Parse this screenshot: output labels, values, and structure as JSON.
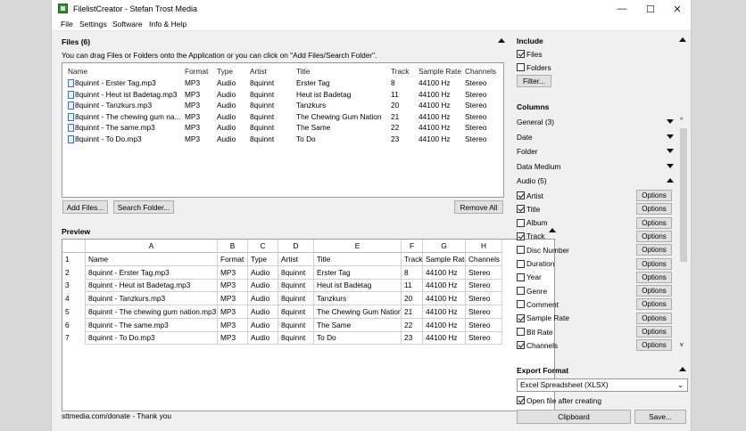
{
  "window": {
    "title": "FilelistCreator - Stefan Trost Media",
    "minimize": "—",
    "maximize": "☐",
    "close": "✕"
  },
  "menu": [
    "File",
    "Settings",
    "Software",
    "Info & Help"
  ],
  "files": {
    "header": "Files (6)",
    "hint": "You can drag Files or Folders onto the Application or you can click on \"Add Files/Search Folder\".",
    "columns": [
      "Name",
      "Format",
      "Type",
      "Artist",
      "Title",
      "Track",
      "Sample Rate",
      "Channels"
    ],
    "rows": [
      [
        "8quinnt - Erster Tag.mp3",
        "MP3",
        "Audio",
        "8quinnt",
        "Erster Tag",
        "8",
        "44100 Hz",
        "Stereo"
      ],
      [
        "8quinnt - Heut ist Badetag.mp3",
        "MP3",
        "Audio",
        "8quinnt",
        "Heut ist Badetag",
        "11",
        "44100 Hz",
        "Stereo"
      ],
      [
        "8quinnt - Tanzkurs.mp3",
        "MP3",
        "Audio",
        "8quinnt",
        "Tanzkurs",
        "20",
        "44100 Hz",
        "Stereo"
      ],
      [
        "8quinnt - The chewing gum na...",
        "MP3",
        "Audio",
        "8quinnt",
        "The Chewing Gum Nation",
        "21",
        "44100 Hz",
        "Stereo"
      ],
      [
        "8quinnt - The same.mp3",
        "MP3",
        "Audio",
        "8quinnt",
        "The Same",
        "22",
        "44100 Hz",
        "Stereo"
      ],
      [
        "8quinnt - To Do.mp3",
        "MP3",
        "Audio",
        "8quinnt",
        "To Do",
        "23",
        "44100 Hz",
        "Stereo"
      ]
    ],
    "add_files": "Add Files...",
    "search_folder": "Search Folder...",
    "remove_all": "Remove All"
  },
  "preview": {
    "header": "Preview",
    "col_letters": [
      "A",
      "B",
      "C",
      "D",
      "E",
      "F",
      "G",
      "H"
    ],
    "rows": [
      [
        "1",
        "Name",
        "Format",
        "Type",
        "Artist",
        "Title",
        "Track",
        "Sample Rate",
        "Channels"
      ],
      [
        "2",
        "8quinnt - Erster Tag.mp3",
        "MP3",
        "Audio",
        "8quinnt",
        "Erster Tag",
        "8",
        "44100 Hz",
        "Stereo"
      ],
      [
        "3",
        "8quinnt - Heut ist Badetag.mp3",
        "MP3",
        "Audio",
        "8quinnt",
        "Heut ist Badetag",
        "11",
        "44100 Hz",
        "Stereo"
      ],
      [
        "4",
        "8quinnt - Tanzkurs.mp3",
        "MP3",
        "Audio",
        "8quinnt",
        "Tanzkurs",
        "20",
        "44100 Hz",
        "Stereo"
      ],
      [
        "5",
        "8quinnt - The chewing gum nation.mp3",
        "MP3",
        "Audio",
        "8quinnt",
        "The Chewing Gum Nation",
        "21",
        "44100 Hz",
        "Stereo"
      ],
      [
        "6",
        "8quinnt - The same.mp3",
        "MP3",
        "Audio",
        "8quinnt",
        "The Same",
        "22",
        "44100 Hz",
        "Stereo"
      ],
      [
        "7",
        "8quinnt - To Do.mp3",
        "MP3",
        "Audio",
        "8quinnt",
        "To Do",
        "23",
        "44100 Hz",
        "Stereo"
      ]
    ]
  },
  "include": {
    "header": "Include",
    "files": "Files",
    "files_checked": true,
    "folders": "Folders",
    "folders_checked": false,
    "filter": "Filter..."
  },
  "columns_panel": {
    "header": "Columns",
    "groups": [
      "General (3)",
      "Date",
      "Folder",
      "Data Medium",
      "Audio (5)"
    ],
    "audio_items": [
      {
        "label": "Artist",
        "checked": true
      },
      {
        "label": "Title",
        "checked": true
      },
      {
        "label": "Album",
        "checked": false
      },
      {
        "label": "Track",
        "checked": true
      },
      {
        "label": "Disc Number",
        "checked": false
      },
      {
        "label": "Duration",
        "checked": false
      },
      {
        "label": "Year",
        "checked": false
      },
      {
        "label": "Genre",
        "checked": false
      },
      {
        "label": "Comment",
        "checked": false
      },
      {
        "label": "Sample Rate",
        "checked": true
      },
      {
        "label": "Bit Rate",
        "checked": false
      },
      {
        "label": "Channels",
        "checked": true
      }
    ],
    "options_label": "Options"
  },
  "export": {
    "header": "Export Format",
    "format": "Excel Spreadsheet (XLSX)",
    "open_after": "Open file after creating",
    "open_after_checked": true,
    "clipboard": "Clipboard",
    "save": "Save..."
  },
  "status": "sttmedia.com/donate - Thank you"
}
